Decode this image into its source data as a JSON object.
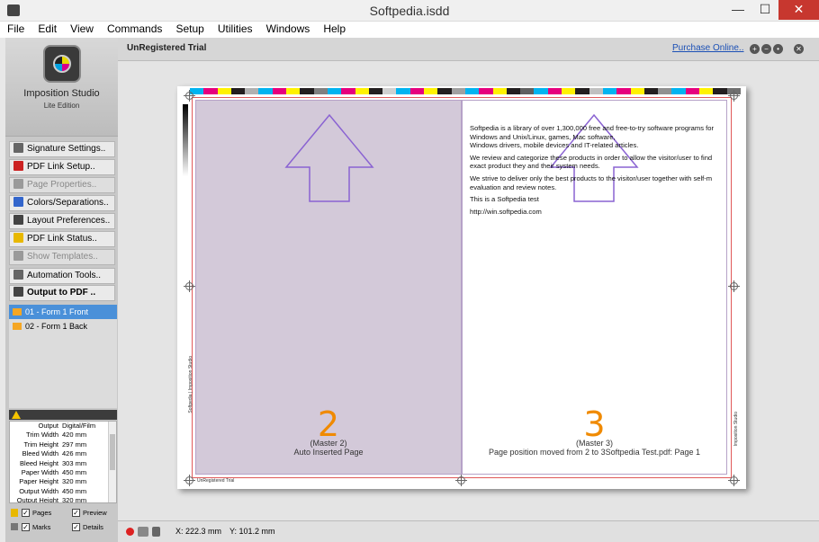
{
  "window": {
    "title": "Softpedia.isdd",
    "minimize": "—",
    "maximize": "☐",
    "close": "✕"
  },
  "menu": [
    "File",
    "Edit",
    "View",
    "Commands",
    "Setup",
    "Utilities",
    "Windows",
    "Help"
  ],
  "logo": {
    "title": "Imposition Studio",
    "subtitle": "Lite Edition"
  },
  "sidebar": {
    "buttons": [
      {
        "label": "Signature Settings..",
        "enabled": true,
        "icon": "grid-icon",
        "color": "#666666"
      },
      {
        "label": "PDF Link Setup..",
        "enabled": true,
        "icon": "pdf-icon",
        "color": "#cc2222"
      },
      {
        "label": "Page Properties..",
        "enabled": false,
        "icon": "page-icon",
        "color": "#9a9a9a"
      },
      {
        "label": "Colors/Separations..",
        "enabled": true,
        "icon": "colors-icon",
        "color": "#3366cc"
      },
      {
        "label": "Layout Preferences..",
        "enabled": true,
        "icon": "gear-icon",
        "color": "#444444"
      },
      {
        "label": "PDF Link Status..",
        "enabled": true,
        "icon": "warning-icon",
        "color": "#e8b800"
      },
      {
        "label": "Show Templates..",
        "enabled": false,
        "icon": "templates-icon",
        "color": "#9a9a9a"
      },
      {
        "label": "Automation Tools..",
        "enabled": true,
        "icon": "automation-icon",
        "color": "#666666"
      },
      {
        "label": "Output to PDF ..",
        "enabled": true,
        "icon": "printer-icon",
        "color": "#444444"
      }
    ],
    "forms": [
      {
        "label": "01 - Form 1 Front",
        "selected": true
      },
      {
        "label": "02 - Form 1 Back",
        "selected": false
      }
    ],
    "properties": [
      {
        "k": "Output",
        "v": "Digital/Film"
      },
      {
        "k": "Trim Width",
        "v": "420 mm"
      },
      {
        "k": "Trim Height",
        "v": "297 mm"
      },
      {
        "k": "Bleed Width",
        "v": "426 mm"
      },
      {
        "k": "Bleed Height",
        "v": "303 mm"
      },
      {
        "k": "Paper Width",
        "v": "450 mm"
      },
      {
        "k": "Paper Height",
        "v": "320 mm"
      },
      {
        "k": "Output Width",
        "v": "450 mm"
      },
      {
        "k": "Output Height",
        "v": "320 mm"
      }
    ],
    "checks": [
      {
        "label": "Pages",
        "checked": true
      },
      {
        "label": "Preview",
        "checked": true
      },
      {
        "label": "Marks",
        "checked": true
      },
      {
        "label": "Details",
        "checked": true
      }
    ]
  },
  "top": {
    "unregistered": "UnRegistered Trial",
    "purchase": "Purchase Online.."
  },
  "pages": {
    "left": {
      "number": "2",
      "master": "(Master 2)",
      "note": "Auto Inserted Page"
    },
    "right": {
      "number": "3",
      "master": "(Master 3)",
      "note": "Page position moved from 2 to 3Softpedia Test.pdf: Page 1",
      "text": [
        "Softpedia is a library of over 1,300,000 free and free-to-try software programs for",
        " Windows and Unix/Linux, games, Mac software,",
        "Windows drivers, mobile devices and IT-related articles.",
        "",
        "We review and categorize these products in order to allow the visitor/user to find",
        " exact product they and their system needs.",
        "",
        "We strive to deliver only the best products to the visitor/user together with self-m",
        " evaluation and review notes.",
        "",
        "This is a Softpedia test",
        "",
        "http://win.softpedia.com"
      ]
    },
    "bottom_label": "UnRegistered Trial",
    "left_side_label": "Softpedia | Imposition Studio",
    "right_side_label": "Imposition Studio"
  },
  "status": {
    "x": "X: 222.3 mm",
    "y": "Y: 101.2 mm"
  },
  "colorbar": [
    "#00b4f0",
    "#e6007e",
    "#fff200",
    "#231f20",
    "#b0b0b0",
    "#00b4f0",
    "#e6007e",
    "#fff200",
    "#231f20",
    "#808080",
    "#00b4f0",
    "#e6007e",
    "#fff200",
    "#231f20",
    "#d0d0d0",
    "#00b4f0",
    "#e6007e",
    "#fff200",
    "#231f20",
    "#a0a0a0",
    "#00b4f0",
    "#e6007e",
    "#fff200",
    "#231f20",
    "#606060",
    "#00b4f0",
    "#e6007e",
    "#fff200",
    "#231f20",
    "#c0c0c0",
    "#00b4f0",
    "#e6007e",
    "#fff200",
    "#231f20",
    "#909090",
    "#00b4f0",
    "#e6007e",
    "#fff200",
    "#231f20",
    "#707070"
  ]
}
